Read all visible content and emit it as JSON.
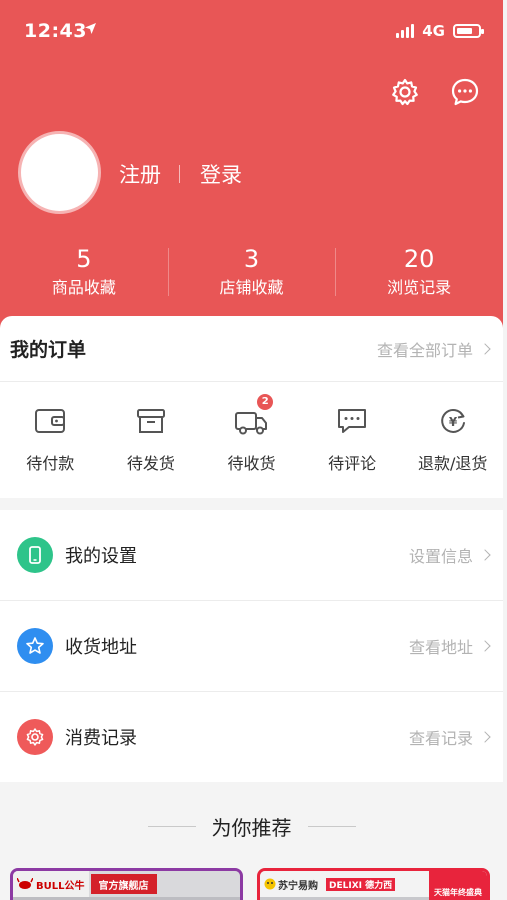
{
  "status_bar": {
    "time": "12:43",
    "network": "4G"
  },
  "header": {
    "register_label": "注册",
    "login_label": "登录",
    "stats": [
      {
        "value": "5",
        "label": "商品收藏"
      },
      {
        "value": "3",
        "label": "店铺收藏"
      },
      {
        "value": "20",
        "label": "浏览记录"
      }
    ]
  },
  "orders": {
    "title": "我的订单",
    "view_all": "查看全部订单",
    "items": [
      {
        "label": "待付款",
        "icon": "wallet-icon"
      },
      {
        "label": "待发货",
        "icon": "box-icon"
      },
      {
        "label": "待收货",
        "icon": "truck-icon",
        "badge": "2"
      },
      {
        "label": "待评论",
        "icon": "comment-icon"
      },
      {
        "label": "退款/退货",
        "icon": "refund-icon"
      }
    ]
  },
  "menu": [
    {
      "label": "我的设置",
      "link": "设置信息",
      "icon": "phone-icon",
      "color": "#2ec48a"
    },
    {
      "label": "收货地址",
      "link": "查看地址",
      "icon": "star-icon",
      "color": "#2f8ef0"
    },
    {
      "label": "消费记录",
      "link": "查看记录",
      "icon": "gear-icon",
      "color": "#ef5a5a"
    }
  ],
  "recommend": {
    "title": "为你推荐",
    "products": [
      {
        "brand": "BULL公牛",
        "tag": "官方旗舰店"
      },
      {
        "brand": "苏宁易购",
        "tag": "DELIXI 德力西",
        "promo": "天猫年终盛典"
      }
    ]
  },
  "colors": {
    "header_bg": "#e85656",
    "badge": "#e85656"
  }
}
